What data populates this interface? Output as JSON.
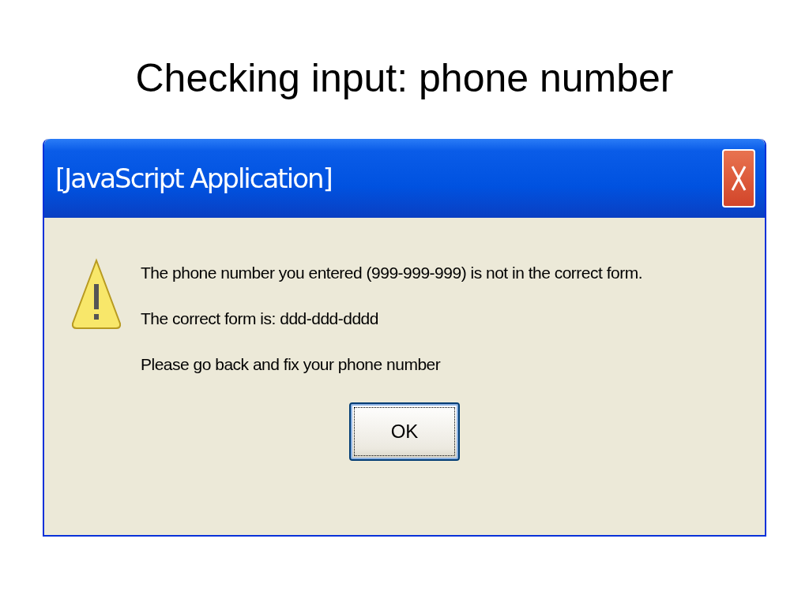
{
  "slide_title": "Checking input: phone number",
  "dialog": {
    "title": "[JavaScript Application]",
    "message_lines": [
      "The phone number you entered (999-999-999) is not in the correct form.",
      "The correct form is: ddd-ddd-dddd",
      "Please go back and fix your phone number"
    ],
    "buttons": [
      {
        "label": "OK",
        "focused": true
      }
    ]
  }
}
